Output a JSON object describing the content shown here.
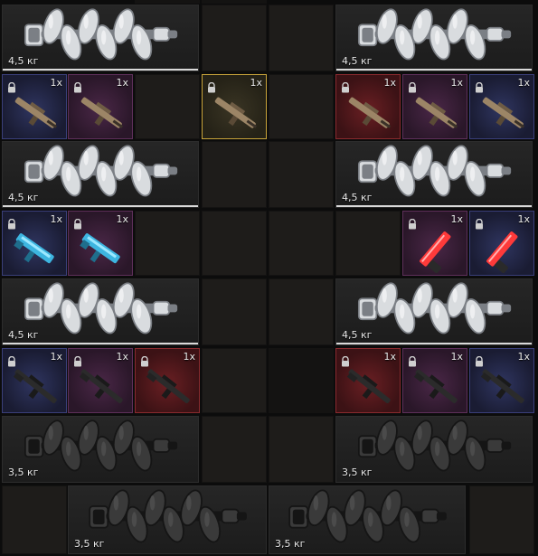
{
  "inventory": {
    "crankshaft_weight_silver": "4,5 кг",
    "crankshaft_weight_dark": "3,5 кг",
    "quantity_label": "1x",
    "items": [
      {
        "name": "crankshaft-silver",
        "weight": "4,5 кг"
      },
      {
        "name": "crankshaft-silver",
        "weight": "4,5 кг"
      },
      {
        "name": "rifle-tan",
        "qty": "1x",
        "rarity": "blue"
      },
      {
        "name": "rifle-tan",
        "qty": "1x",
        "rarity": "purple"
      },
      {
        "name": "rifle-tan",
        "qty": "1x",
        "rarity": "gold"
      },
      {
        "name": "rifle-tan",
        "qty": "1x",
        "rarity": "red"
      },
      {
        "name": "rifle-tan",
        "qty": "1x",
        "rarity": "purple"
      },
      {
        "name": "rifle-tan",
        "qty": "1x",
        "rarity": "blue"
      },
      {
        "name": "crankshaft-silver",
        "weight": "4,5 кг"
      },
      {
        "name": "crankshaft-silver",
        "weight": "4,5 кг"
      },
      {
        "name": "smg-cyan",
        "qty": "1x",
        "rarity": "blue"
      },
      {
        "name": "smg-cyan",
        "qty": "1x",
        "rarity": "purple"
      },
      {
        "name": "pistol-red",
        "qty": "1x",
        "rarity": "purple"
      },
      {
        "name": "pistol-red",
        "qty": "1x",
        "rarity": "blue"
      },
      {
        "name": "crankshaft-silver",
        "weight": "4,5 кг"
      },
      {
        "name": "crankshaft-silver",
        "weight": "4,5 кг"
      },
      {
        "name": "rifle-black",
        "qty": "1x",
        "rarity": "blue"
      },
      {
        "name": "rifle-black",
        "qty": "1x",
        "rarity": "purple"
      },
      {
        "name": "rifle-black",
        "qty": "1x",
        "rarity": "red"
      },
      {
        "name": "rifle-black",
        "qty": "1x",
        "rarity": "red"
      },
      {
        "name": "rifle-black",
        "qty": "1x",
        "rarity": "purple"
      },
      {
        "name": "rifle-black",
        "qty": "1x",
        "rarity": "blue"
      },
      {
        "name": "crankshaft-dark",
        "weight": "3,5 кг"
      },
      {
        "name": "crankshaft-dark",
        "weight": "3,5 кг"
      },
      {
        "name": "crankshaft-dark",
        "weight": "3,5 кг"
      },
      {
        "name": "crankshaft-dark",
        "weight": "3,5 кг"
      }
    ]
  },
  "colors": {
    "rarity_blue": "#3a3f7a",
    "rarity_purple": "#5e2f5a",
    "rarity_red": "#8a2a2e",
    "rarity_gold": "#c9a43a",
    "crank_silver": "#b9bcc0",
    "crank_dark": "#2a2a2a"
  }
}
